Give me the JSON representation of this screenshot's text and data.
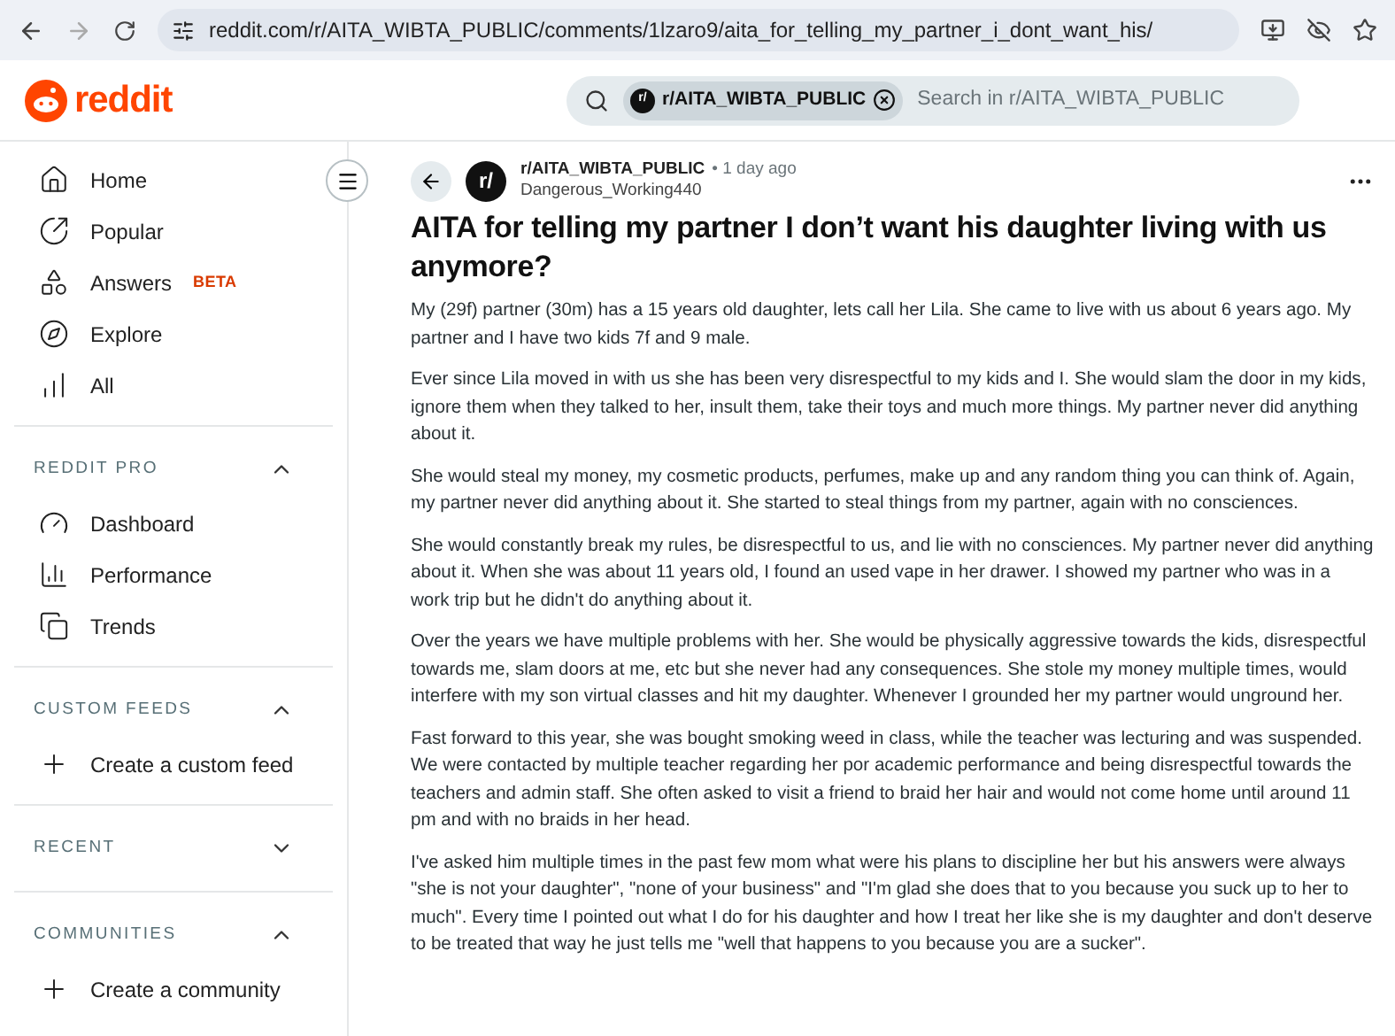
{
  "browser": {
    "url": "reddit.com/r/AITA_WIBTA_PUBLIC/comments/1lzaro9/aita_for_telling_my_partner_i_dont_want_his/"
  },
  "header": {
    "logo": "reddit",
    "search": {
      "chip_icon": "r/",
      "chip": "r/AITA_WIBTA_PUBLIC",
      "placeholder": "Search in r/AITA_WIBTA_PUBLIC"
    }
  },
  "sidebar": {
    "items": [
      {
        "label": "Home"
      },
      {
        "label": "Popular"
      },
      {
        "label": "Answers",
        "badge": "BETA"
      },
      {
        "label": "Explore"
      },
      {
        "label": "All"
      }
    ],
    "sections": [
      {
        "title": "REDDIT PRO",
        "expanded": true,
        "items": [
          {
            "label": "Dashboard"
          },
          {
            "label": "Performance"
          },
          {
            "label": "Trends"
          }
        ]
      },
      {
        "title": "CUSTOM FEEDS",
        "expanded": true,
        "items": [
          {
            "label": "Create a custom feed"
          }
        ]
      },
      {
        "title": "RECENT",
        "expanded": false
      },
      {
        "title": "COMMUNITIES",
        "expanded": true,
        "items": [
          {
            "label": "Create a community"
          }
        ]
      }
    ]
  },
  "post": {
    "community_icon": "r/",
    "community": "r/AITA_WIBTA_PUBLIC",
    "time": "• 1 day ago",
    "author": "Dangerous_Working440",
    "title": "AITA for telling my partner I don’t want his daughter living with us anymore?",
    "paragraphs": [
      "My (29f) partner (30m) has a 15 years old daughter, lets call her Lila. She came to live with us about 6 years ago. My partner and I have two kids 7f and 9 male.",
      "Ever since Lila moved in with us she has been very disrespectful to my kids and I. She would slam the door in my kids, ignore them when they talked to her, insult them, take their toys and much more things. My partner never did anything about it.",
      "She would steal my money, my cosmetic products, perfumes, make up and any random thing you can think of. Again, my partner never did anything about it. She started to steal things from my partner, again with no consciences.",
      "She would constantly break my rules, be disrespectful to us, and lie with no consciences. My partner never did anything about it. When she was about 11 years old, I found an used vape in her drawer. I showed my partner who was in a work trip but he didn't do anything about it.",
      "Over the years we have multiple problems with her. She would be physically aggressive towards the kids, disrespectful towards me, slam doors at me, etc but she never had any consequences. She stole my money multiple times, would interfere with my son virtual classes and hit my daughter. Whenever I grounded her my partner would unground her.",
      "Fast forward to this year, she was bought smoking weed in class, while the teacher was lecturing and was suspended. We were contacted by multiple teacher regarding her por academic performance and being disrespectful towards the teachers and admin staff. She often asked to visit a friend to braid her hair and would not come home until around 11 pm and with no braids in her head.",
      "I've asked him multiple times in the past few mom what were his plans to discipline her but his answers were always \"she is not your daughter\", \"none of your business\" and \"I'm glad she does that to you because you suck up to her to much\". Every time I pointed out what I do for his daughter and how I treat her like she is my daughter and don't deserve to be treated that way he just tells me \"well that happens to you because you are a sucker\"."
    ]
  }
}
